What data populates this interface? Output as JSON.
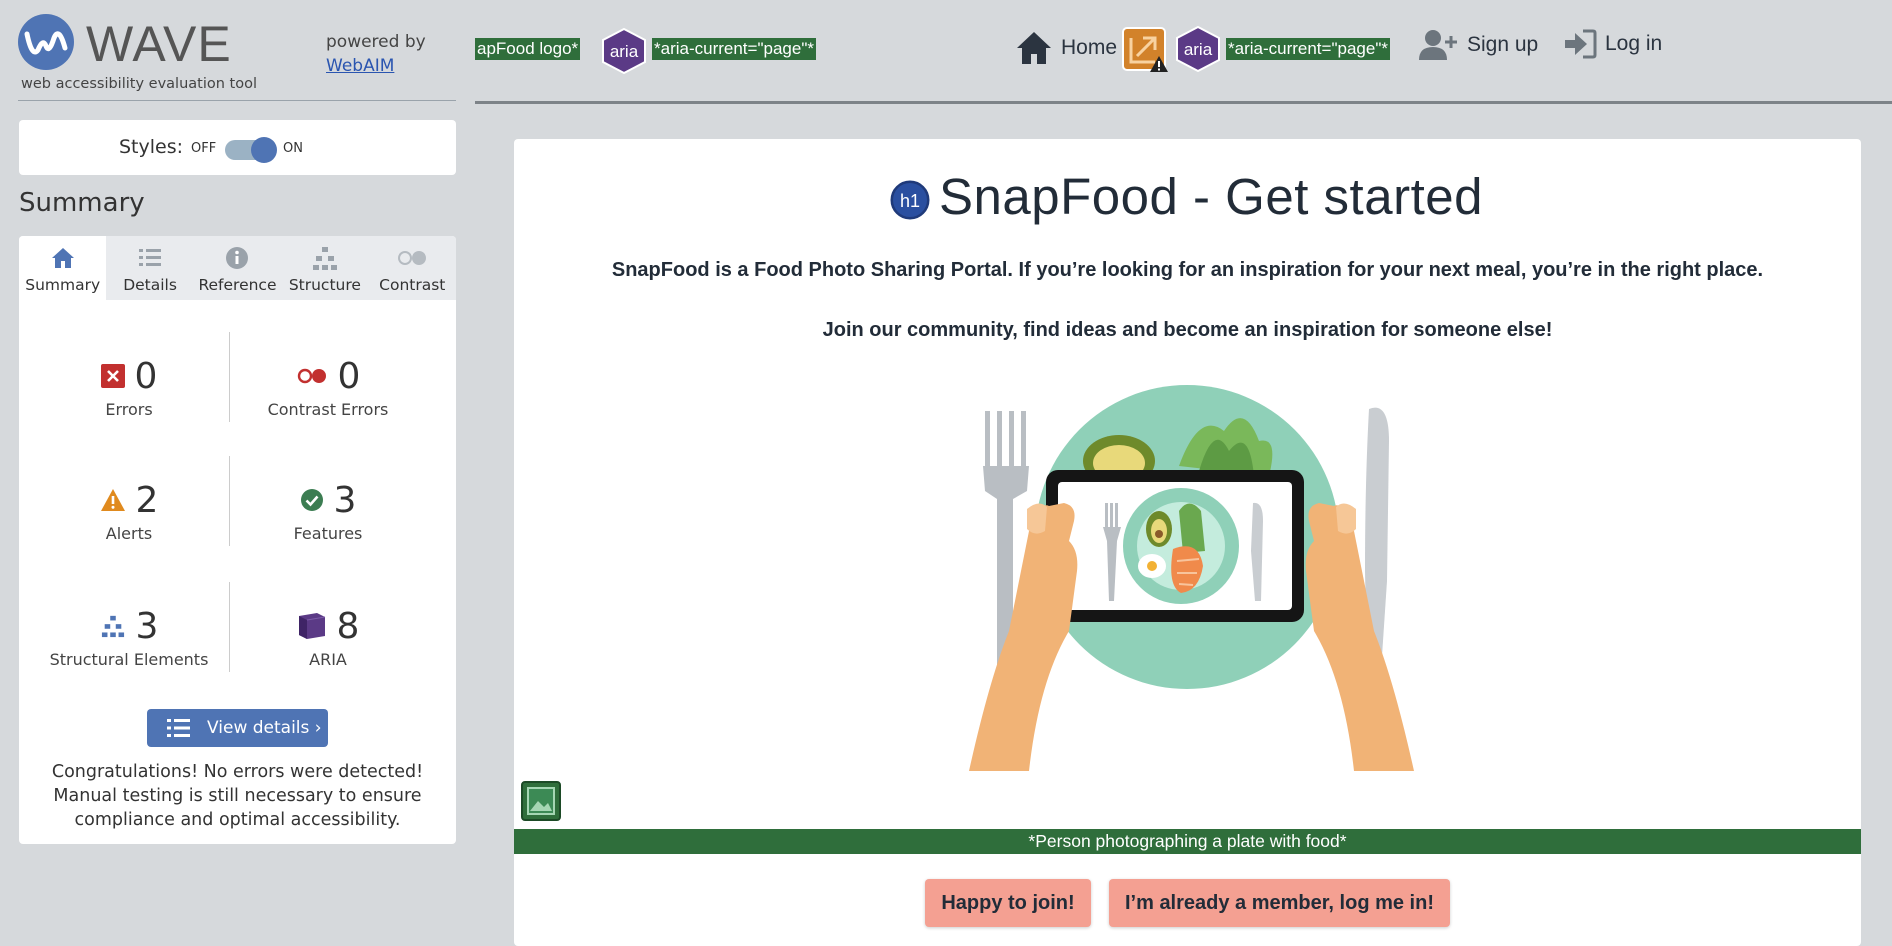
{
  "wave": {
    "title": "WAVE",
    "subtitle": "web accessibility evaluation tool",
    "powered_by": "powered by",
    "powered_link": "WebAIM",
    "styles_label": "Styles:",
    "toggle_off": "OFF",
    "toggle_on": "ON",
    "toggle_state": "on",
    "summary_heading": "Summary",
    "tabs": [
      {
        "label": "Summary",
        "icon": "home-icon",
        "active": true
      },
      {
        "label": "Details",
        "icon": "list-icon",
        "active": false
      },
      {
        "label": "Reference",
        "icon": "info-icon",
        "active": false
      },
      {
        "label": "Structure",
        "icon": "hierarchy-icon",
        "active": false
      },
      {
        "label": "Contrast",
        "icon": "contrast-icon",
        "active": false
      }
    ],
    "stats": {
      "errors": {
        "count": "0",
        "label": "Errors",
        "icon": "error-x-icon"
      },
      "contrast_errors": {
        "count": "0",
        "label": "Contrast Errors",
        "icon": "contrast-error-icon"
      },
      "alerts": {
        "count": "2",
        "label": "Alerts",
        "icon": "alert-triangle-icon"
      },
      "features": {
        "count": "3",
        "label": "Features",
        "icon": "feature-check-icon"
      },
      "structural": {
        "count": "3",
        "label": "Structural Elements",
        "icon": "structure-icon"
      },
      "aria": {
        "count": "8",
        "label": "ARIA",
        "icon": "aria-cube-icon"
      }
    },
    "view_details": "View details ›",
    "congrats": "Congratulations! No errors were detected! Manual testing is still necessary to ensure compliance and optimal accessibility."
  },
  "header": {
    "logo_alt_tag": "apFood logo*",
    "aria_label": "aria",
    "aria_current_1": "*aria-current=\"page\"*",
    "nav_home": "Home",
    "aria_current_2": "*aria-current=\"page\"*",
    "nav_signup": "Sign up",
    "nav_login": "Log in"
  },
  "main": {
    "h1_badge": "h1",
    "title": "SnapFood - Get started",
    "intro": "SnapFood is a Food Photo Sharing Portal. If you’re looking for an inspiration for your next meal, you’re in the right place.",
    "join_text": "Join our community, find ideas and become an inspiration for someone else!",
    "image_caption": "*Person photographing a plate with food*",
    "btn_join": "Happy to join!",
    "btn_login": "I’m already a member, log me in!"
  },
  "colors": {
    "wave_blue": "#4f74b4",
    "wave_green_tag": "#2f6e3b",
    "aria_purple": "#5b3a86",
    "cta_salmon": "#f4a092",
    "plate_teal": "#8fd0b8"
  }
}
